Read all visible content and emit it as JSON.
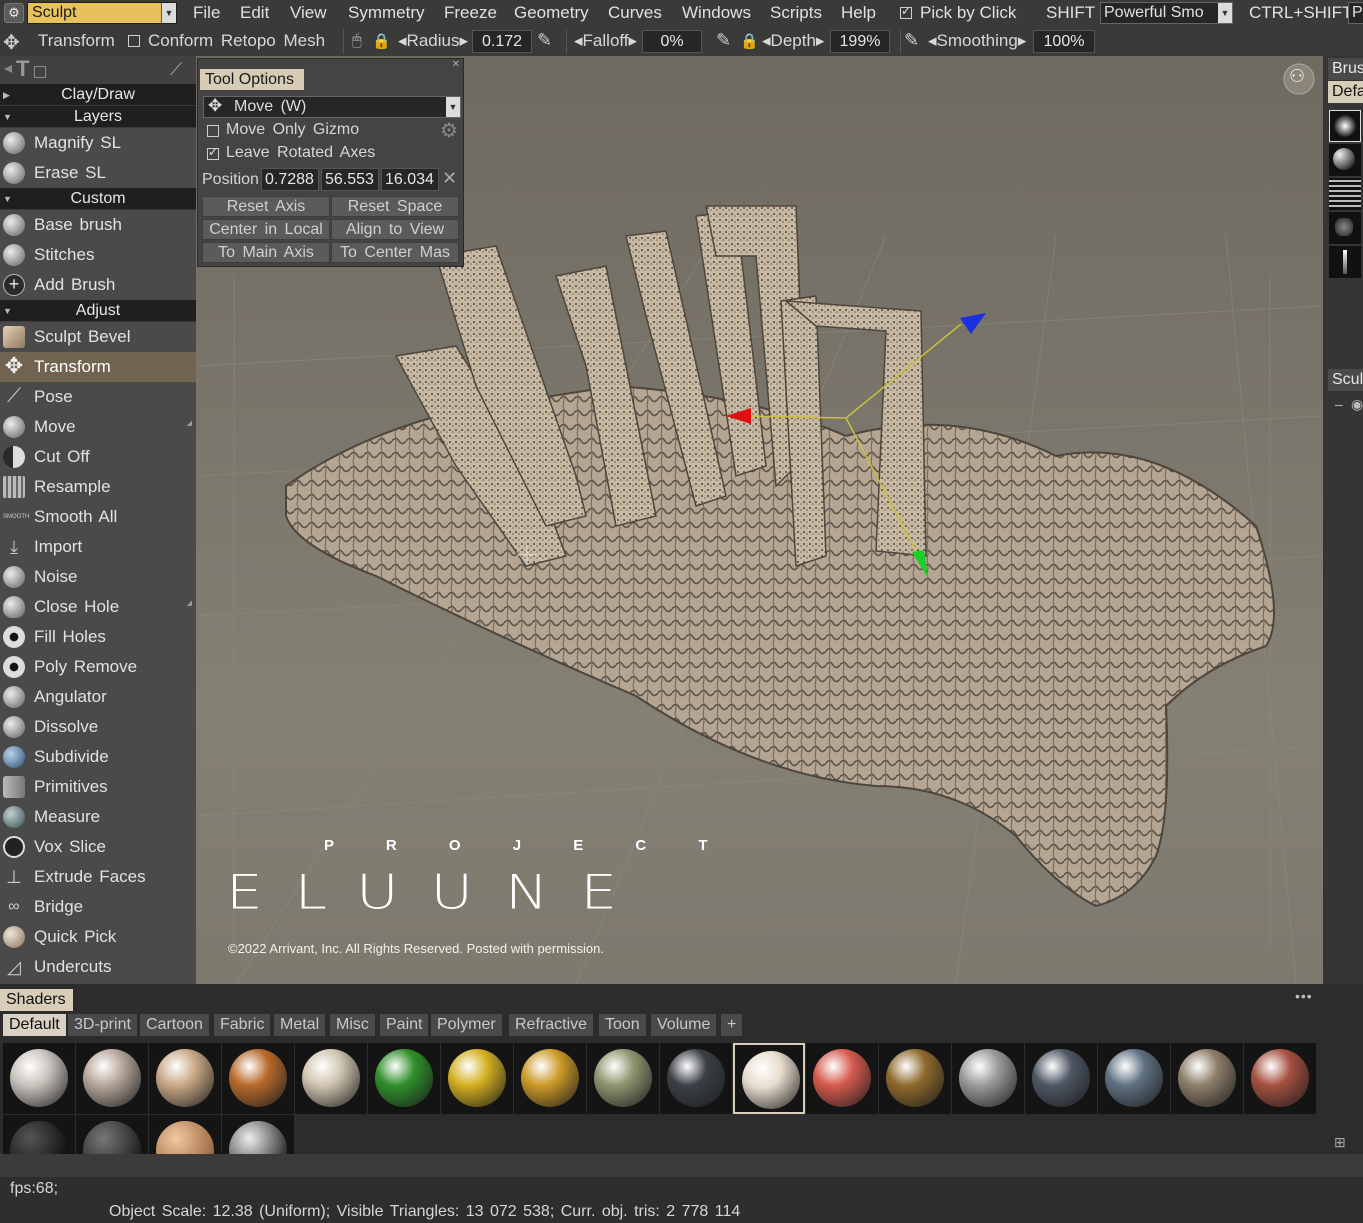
{
  "menubar": {
    "room": "Sculpt",
    "items": [
      "File",
      "Edit",
      "View",
      "Symmetry",
      "Freeze",
      "Geometry",
      "Curves",
      "Windows",
      "Scripts",
      "Help"
    ],
    "pick_by_click": "Pick by Click",
    "shift_label": "SHIFT",
    "shift_value": "Powerful Smo",
    "ctrl_shift_label": "CTRL+SHIFT",
    "ctrl_shift_value": "Po"
  },
  "toolbar": {
    "tool_name": "Transform",
    "conform": "Conform Retopo Mesh",
    "radius_label": "Radius",
    "radius_value": "0.172",
    "falloff_label": "Falloff",
    "falloff_value": "0%",
    "depth_label": "Depth",
    "depth_value": "199%",
    "smoothing_label": "Smoothing",
    "smoothing_value": "100%"
  },
  "left_panel": {
    "sections": {
      "clay": "Clay/Draw",
      "layers": "Layers",
      "custom": "Custom",
      "adjust": "Adjust"
    },
    "layers_tools": [
      "Magnify SL",
      "Erase SL"
    ],
    "custom_tools": [
      "Base brush",
      "Stitches",
      "Add Brush"
    ],
    "adjust_tools": [
      "Sculpt Bevel",
      "Transform",
      "Pose",
      "Move",
      "Cut Off",
      "Resample",
      "Smooth All",
      "Import",
      "Noise",
      "Close Hole",
      "Fill Holes",
      "Poly Remove",
      "Angulator",
      "Dissolve",
      "Subdivide",
      "Primitives",
      "Measure",
      "Vox Slice",
      "Extrude Faces",
      "Bridge",
      "Quick Pick",
      "Undercuts"
    ],
    "active_tool": "Transform"
  },
  "tool_options": {
    "title": "Tool Options",
    "mode": "Move (W)",
    "move_only_gizmo": "Move Only Gizmo",
    "leave_rotated_axes": "Leave Rotated Axes",
    "position_label": "Position",
    "position": [
      "0.7288",
      "56.553",
      "16.034"
    ],
    "buttons": [
      "Reset Axis",
      "Reset Space",
      "Center in Local",
      "Align to View",
      "To Main Axis",
      "To Center Mas"
    ]
  },
  "viewport": {
    "logo_top": "P R O J E C T",
    "logo_main": "ELUUNE",
    "copyright": "©2022 Arrivant, Inc. All Rights Reserved. Posted with permission."
  },
  "right_panel": {
    "brush_tab": "Brus",
    "default_tab": "Defa",
    "sculpt_tab": "Scul"
  },
  "shaders": {
    "title": "Shaders",
    "tabs": [
      "Default",
      "3D-print",
      "Cartoon",
      "Fabric",
      "Metal",
      "Misc",
      "Paint",
      "Polymer",
      "Refractive",
      "Toon",
      "Volume",
      "+"
    ],
    "active_tab": "Default",
    "ball_colors": [
      "#c9c3bd",
      "#b5a69b",
      "#c9a886",
      "#b86a2c",
      "#cfc4b0",
      "#2f8f2a",
      "#d4b020",
      "#cc9a28",
      "#8d9670",
      "#3b3f46",
      "#e6dccd",
      "#d65a4e",
      "#8f6a2c",
      "#9a9a9a",
      "#4d5663",
      "#5f7182",
      "#8d7e6a",
      "#a65041"
    ]
  },
  "status": {
    "fps": "fps:68;",
    "info": "Object Scale: 12.38 (Uniform); Visible Triangles: 13 072 538; Curr. obj. tris: 2 778 114"
  }
}
